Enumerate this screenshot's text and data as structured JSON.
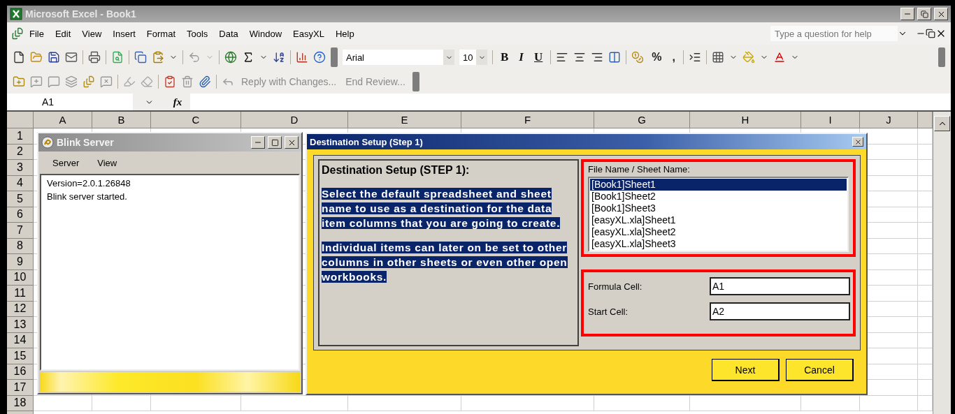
{
  "window": {
    "title": "Microsoft Excel - Book1"
  },
  "menu": [
    "File",
    "Edit",
    "View",
    "Insert",
    "Format",
    "Tools",
    "Data",
    "Window",
    "EasyXL",
    "Help"
  ],
  "help_search": {
    "placeholder": "Type a question for help"
  },
  "formatting": {
    "font": "Arial",
    "size": "10",
    "styles": [
      "B",
      "I",
      "U"
    ],
    "number_formats": [
      "%",
      ","
    ]
  },
  "reviewing": [
    "Reply with Changes...",
    "End Review..."
  ],
  "name_box": "A1",
  "formula_label": "fx",
  "columns": [
    "A",
    "B",
    "C",
    "D",
    "E",
    "F",
    "G",
    "H",
    "I",
    "J"
  ],
  "rows": [
    "1",
    "2",
    "3",
    "4",
    "5",
    "6",
    "7",
    "8",
    "9",
    "10",
    "11",
    "12",
    "13",
    "14",
    "15",
    "16",
    "17",
    "18"
  ],
  "blink": {
    "title": "Blink Server",
    "menu": [
      "Server",
      "View"
    ],
    "log": [
      "Version=2.0.1.26848",
      "Blink server started."
    ]
  },
  "dialog": {
    "title": "Destination Setup (Step 1)",
    "heading": "Destination Setup (STEP 1):",
    "paragraphs": [
      "Select the default spreadsheet and sheet name to use as a destination for the data item columns that you are going to create.",
      "Individual items can later on be set to other columns in other sheets or even other open workbooks."
    ],
    "list_label": "File Name / Sheet Name:",
    "sheets": [
      {
        "label": "[Book1]Sheet1",
        "selected": true
      },
      {
        "label": "[Book1]Sheet2",
        "selected": false
      },
      {
        "label": "[Book1]Sheet3",
        "selected": false
      },
      {
        "label": "[easyXL.xla]Sheet1",
        "selected": false
      },
      {
        "label": "[easyXL.xla]Sheet2",
        "selected": false
      },
      {
        "label": "[easyXL.xla]Sheet3",
        "selected": false
      }
    ],
    "fields": [
      {
        "label": "Formula Cell:",
        "value": "A1"
      },
      {
        "label": "Start Cell:",
        "value": "A2"
      }
    ],
    "buttons": [
      "Next",
      "Cancel"
    ]
  }
}
